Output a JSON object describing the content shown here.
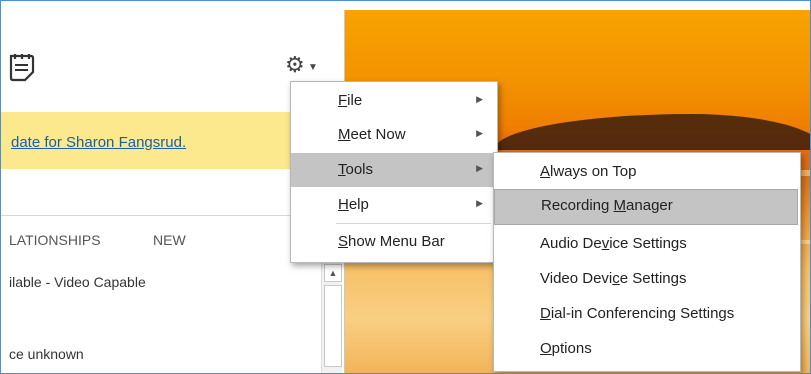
{
  "banner": {
    "link_text": "date for Sharon Fangsrud."
  },
  "tabs": {
    "relationships": "LATIONSHIPS",
    "new": "NEW"
  },
  "contacts": [
    "ilable - Video Capable",
    "ce unknown"
  ],
  "main_menu": {
    "items": [
      {
        "label": "File",
        "mnemonic": "F",
        "rest": "ile",
        "has_submenu": true
      },
      {
        "label": "Meet Now",
        "mnemonic": "M",
        "rest": "eet Now",
        "has_submenu": true
      },
      {
        "label": "Tools",
        "mnemonic": "T",
        "rest": "ools",
        "has_submenu": true,
        "selected": true
      },
      {
        "label": "Help",
        "mnemonic": "H",
        "rest": "elp",
        "has_submenu": true
      },
      {
        "label": "Show Menu Bar",
        "mnemonic": "S",
        "rest": "how Menu Bar",
        "has_submenu": false
      }
    ]
  },
  "tools_submenu": {
    "items": [
      {
        "pre": "",
        "mn": "A",
        "post": "lways on Top"
      },
      {
        "pre": "Recording ",
        "mn": "M",
        "post": "anager",
        "highlighted": true
      },
      {
        "pre": "Audio De",
        "mn": "v",
        "post": "ice Settings"
      },
      {
        "pre": "Video Devi",
        "mn": "c",
        "post": "e Settings"
      },
      {
        "pre": "",
        "mn": "D",
        "post": "ial-in Conferencing Settings"
      },
      {
        "pre": "",
        "mn": "O",
        "post": "ptions"
      }
    ]
  },
  "icons": {
    "gear": "gear-icon",
    "caret": "caret-down-icon",
    "notes": "notes-icon",
    "submenu_arrow": "submenu-arrow-icon",
    "scroll_up": "scroll-up-arrow-icon"
  },
  "colors": {
    "banner": "#fce88d",
    "link": "#1a5fa8",
    "selection": "#c4c4c4",
    "frame_border": "#4a90d9"
  }
}
